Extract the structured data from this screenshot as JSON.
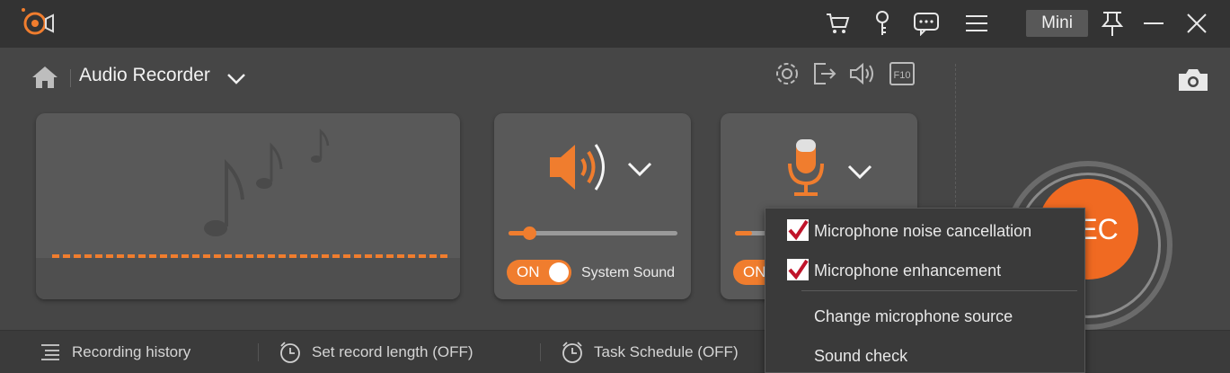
{
  "window": {
    "mini_label": "Mini"
  },
  "titlebar_icons": [
    "cart-icon",
    "key-icon",
    "feedback-icon",
    "menu-icon",
    "pin-icon",
    "minimize-icon",
    "close-icon"
  ],
  "header": {
    "mode_title": "Audio Recorder"
  },
  "tools": [
    "settings-icon",
    "export-icon",
    "volume-icon",
    "f10-hotkey-icon"
  ],
  "system_sound": {
    "toggle": "ON",
    "label": "System Sound",
    "volume": 0.12
  },
  "microphone": {
    "toggle": "ON",
    "volume": 0.1
  },
  "rec": {
    "label": "REC"
  },
  "bottom": {
    "history": "Recording history",
    "length": "Set record length (OFF)",
    "schedule": "Task Schedule (OFF)"
  },
  "mic_menu": {
    "noise_cancellation": "Microphone noise cancellation",
    "noise_cancellation_checked": true,
    "enhancement": "Microphone enhancement",
    "enhancement_checked": true,
    "change_source": "Change microphone source",
    "sound_check": "Sound check"
  },
  "colors": {
    "accent": "#f07d2e",
    "rec": "#f06a22",
    "check": "#c0142a"
  }
}
